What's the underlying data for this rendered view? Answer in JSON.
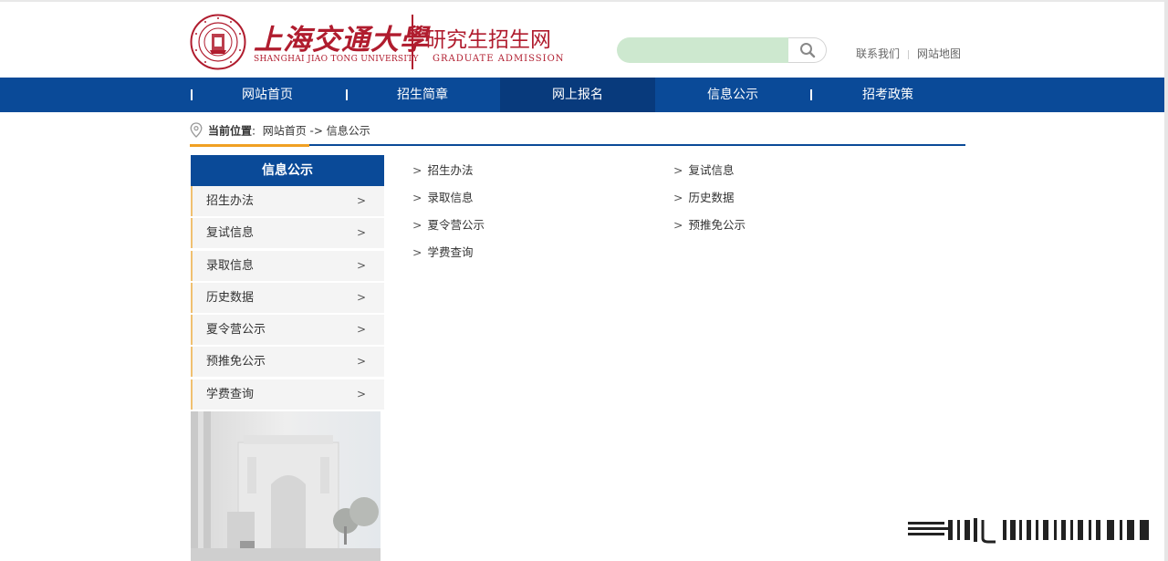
{
  "header": {
    "logo_cn": "上海交通大學",
    "logo_en": "SHANGHAI JIAO TONG UNIVERSITY",
    "site_cn": "研究生招生网",
    "site_en": "GRADUATE ADMISSION",
    "search_placeholder": "",
    "links": [
      {
        "label": "联系我们"
      },
      {
        "label": "网站地图"
      }
    ]
  },
  "nav": {
    "items": [
      {
        "label": "网站首页"
      },
      {
        "label": "招生简章"
      },
      {
        "label": "网上报名"
      },
      {
        "label": "信息公示"
      },
      {
        "label": "招考政策"
      }
    ],
    "active_index": 2
  },
  "breadcrumb": {
    "prefix": "当前位置",
    "colon": ":",
    "home": "网站首页",
    "arrow": "->",
    "current": "信息公示"
  },
  "sidebar": {
    "title": "信息公示",
    "arrow_glyph": ">",
    "items": [
      {
        "label": "招生办法"
      },
      {
        "label": "复试信息"
      },
      {
        "label": "录取信息"
      },
      {
        "label": "历史数据"
      },
      {
        "label": "夏令营公示"
      },
      {
        "label": "预推免公示"
      },
      {
        "label": "学费查询"
      }
    ]
  },
  "content": {
    "bullet": ">",
    "links": [
      {
        "label": "招生办法"
      },
      {
        "label": "复试信息"
      },
      {
        "label": "录取信息"
      },
      {
        "label": "历史数据"
      },
      {
        "label": "夏令营公示"
      },
      {
        "label": "预推免公示"
      },
      {
        "label": "学费查询"
      }
    ]
  },
  "colors": {
    "brand_red": "#b01c2e",
    "nav_blue": "#0a4a98",
    "nav_active": "#083a7c",
    "accent_orange": "#f0a023",
    "search_bg": "#cde8cf"
  },
  "icons": {
    "logo": "university-seal-icon",
    "search": "search-icon",
    "location": "location-pin-icon"
  }
}
